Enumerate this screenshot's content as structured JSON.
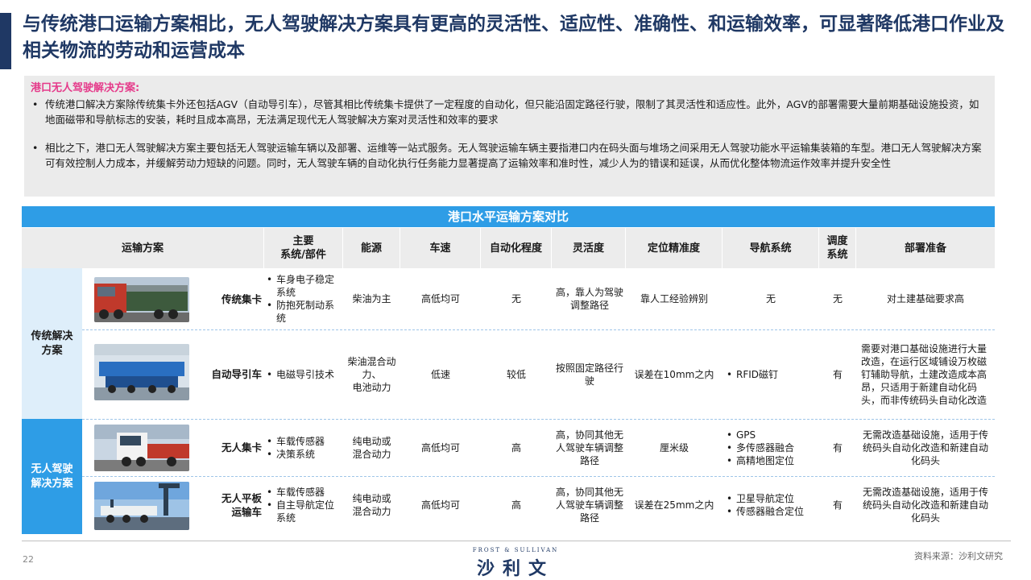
{
  "title": "与传统港口运输方案相比，无人驾驶解决方案具有更高的灵活性、适应性、准确性、和运输效率，可显著降低港口作业及相关物流的劳动和运营成本",
  "intro": {
    "heading": "港口无人驾驶解决方案:",
    "bullets": [
      "传统港口解决方案除传统集卡外还包括AGV（自动导引车），尽管其相比传统集卡提供了一定程度的自动化，但只能沿固定路径行驶，限制了其灵活性和适应性。此外，AGV的部署需要大量前期基础设施投资，如地面磁带和导航标志的安装，耗时且成本高昂，无法满足现代无人驾驶解决方案对灵活性和效率的要求",
      "相比之下，港口无人驾驶解决方案主要包括无人驾驶运输车辆以及部署、运维等一站式服务。无人驾驶运输车辆主要指港口内在码头面与堆场之间采用无人驾驶功能水平运输集装箱的车型。港口无人驾驶解决方案可有效控制人力成本，并缓解劳动力短缺的问题。同时，无人驾驶车辆的自动化执行任务能力显著提高了运输效率和准时性，减少人为的错误和延误，从而优化整体物流运作效率并提升安全性"
    ],
    "bullet_glyph": "•"
  },
  "table": {
    "banner": "港口水平运输方案对比",
    "headers": {
      "scheme": "运输方案",
      "system": "主要\n系统/部件",
      "energy": "能源",
      "speed": "车速",
      "automation": "自动化程度",
      "flexibility": "灵活度",
      "precision": "定位精准度",
      "navigation": "导航系统",
      "dispatch": "调度\n系统",
      "deployment": "部署准备"
    },
    "groups": [
      {
        "label": "传统解决\n方案"
      },
      {
        "label": "无人驾驶\n解决方案"
      }
    ],
    "rows": [
      {
        "name": "传统集卡",
        "system": [
          "车身电子稳定系统",
          "防抱死制动系统"
        ],
        "energy": "柴油为主",
        "speed": "高低均可",
        "automation": "无",
        "flexibility": "高，靠人为驾驶调整路径",
        "precision": "靠人工经验辨别",
        "navigation": "无",
        "navigation_list": [],
        "dispatch": "无",
        "deployment": "对土建基础要求高"
      },
      {
        "name": "自动导引车",
        "system": [
          "电磁导引技术"
        ],
        "energy": "柴油混合动力、\n电池动力",
        "speed": "低速",
        "automation": "较低",
        "flexibility": "按照固定路径行驶",
        "precision": "误差在10mm之内",
        "navigation": "",
        "navigation_list": [
          "RFID磁钉"
        ],
        "dispatch": "有",
        "deployment": "需要对港口基础设施进行大量改造，在运行区域铺设万枚磁钉辅助导航，土建改造成本高昂，只适用于新建自动化码头，而非传统码头自动化改造"
      },
      {
        "name": "无人集卡",
        "system": [
          "车载传感器",
          "决策系统"
        ],
        "energy": "纯电动或\n混合动力",
        "speed": "高低均可",
        "automation": "高",
        "flexibility": "高，协同其他无人驾驶车辆调整路径",
        "precision": "厘米级",
        "navigation": "",
        "navigation_list": [
          "GPS",
          "多传感器融合",
          "高精地图定位"
        ],
        "dispatch": "有",
        "deployment": "无需改造基础设施，适用于传统码头自动化改造和新建自动化码头"
      },
      {
        "name": "无人平板\n运输车",
        "system": [
          "车载传感器",
          "自主导航定位系统"
        ],
        "energy": "纯电动或\n混合动力",
        "speed": "高低均可",
        "automation": "高",
        "flexibility": "高，协同其他无人驾驶车辆调整路径",
        "precision": "误差在25mm之内",
        "navigation": "",
        "navigation_list": [
          "卫星导航定位",
          "传感器融合定位"
        ],
        "dispatch": "有",
        "deployment": "无需改造基础设施，适用于传统码头自动化改造和新建自动化码头"
      }
    ]
  },
  "footer": {
    "page": "22",
    "brand_tagline": "FROST & SULLIVAN",
    "brand_name": "沙利文",
    "source": "资料来源：沙利文研究"
  },
  "colors": {
    "title": "#1f3864",
    "accent_pink": "#e53a8a",
    "banner_blue": "#2e9de6",
    "light_blue": "#deeefa"
  }
}
